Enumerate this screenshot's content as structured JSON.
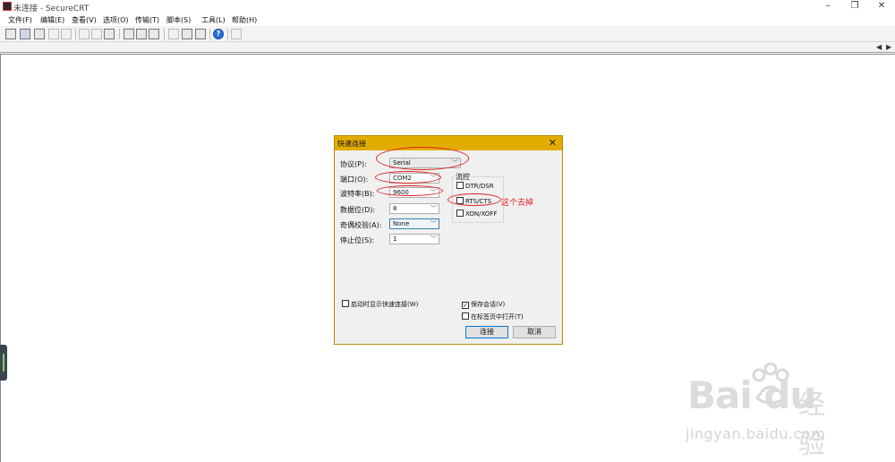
{
  "window": {
    "title": "未连接 - SecureCRT",
    "minimize": "–",
    "maximize": "❐",
    "close": "✕"
  },
  "menubar": {
    "items": [
      {
        "label": "文件(F)"
      },
      {
        "label": "编辑(E)"
      },
      {
        "label": "查看(V)"
      },
      {
        "label": "选项(O)"
      },
      {
        "label": "传输(T)"
      },
      {
        "label": "脚本(S)"
      },
      {
        "label": "工具(L)"
      },
      {
        "label": "帮助(H)"
      }
    ]
  },
  "toolbar": {
    "icons": [
      "connect-icon",
      "quick-connect-icon",
      "connect-in-tab-icon",
      "reconnect-icon",
      "disconnect-icon",
      "copy-icon",
      "paste-icon",
      "find-icon",
      "print-icon",
      "print-selection-icon",
      "print-setup-icon",
      "session-options-icon",
      "global-options-icon",
      "keymap-icon",
      "help-icon",
      "sftp-icon"
    ]
  },
  "dialog": {
    "title": "快速连接",
    "close": "✕",
    "fields": {
      "protocol": {
        "label": "协议(P):",
        "value": "Serial"
      },
      "port": {
        "label": "端口(O):",
        "value": "COM2"
      },
      "baud": {
        "label": "波特率(B):",
        "value": "9600"
      },
      "databits": {
        "label": "数据位(D):",
        "value": "8"
      },
      "parity": {
        "label": "奇偶校验(A):",
        "value": "None"
      },
      "stopbits": {
        "label": "停止位(S):",
        "value": "1"
      }
    },
    "flow": {
      "title": "流控",
      "dtr_dsr": {
        "label": "DTR/DSR",
        "checked": false
      },
      "rts_cts": {
        "label": "RTS/CTS",
        "checked": false
      },
      "xon_xoff": {
        "label": "XON/XOFF",
        "checked": false
      }
    },
    "show_on_startup": {
      "label": "启动时显示快速连接(W)",
      "checked": false
    },
    "save_session": {
      "label": "保存会话(V)",
      "checked": true
    },
    "open_in_tab": {
      "label": "在标签页中打开(T)",
      "checked": false
    },
    "connect_button": "连接",
    "cancel_button": "取消"
  },
  "annotation": {
    "text": "这个去掉",
    "color": "#e02020"
  },
  "watermark": {
    "logo": "Bai du",
    "jing": "经验",
    "url": "jingyan.baidu.com"
  },
  "colors": {
    "dialog_titlebar": "#e2ad00",
    "annotation_red": "#e02020"
  }
}
